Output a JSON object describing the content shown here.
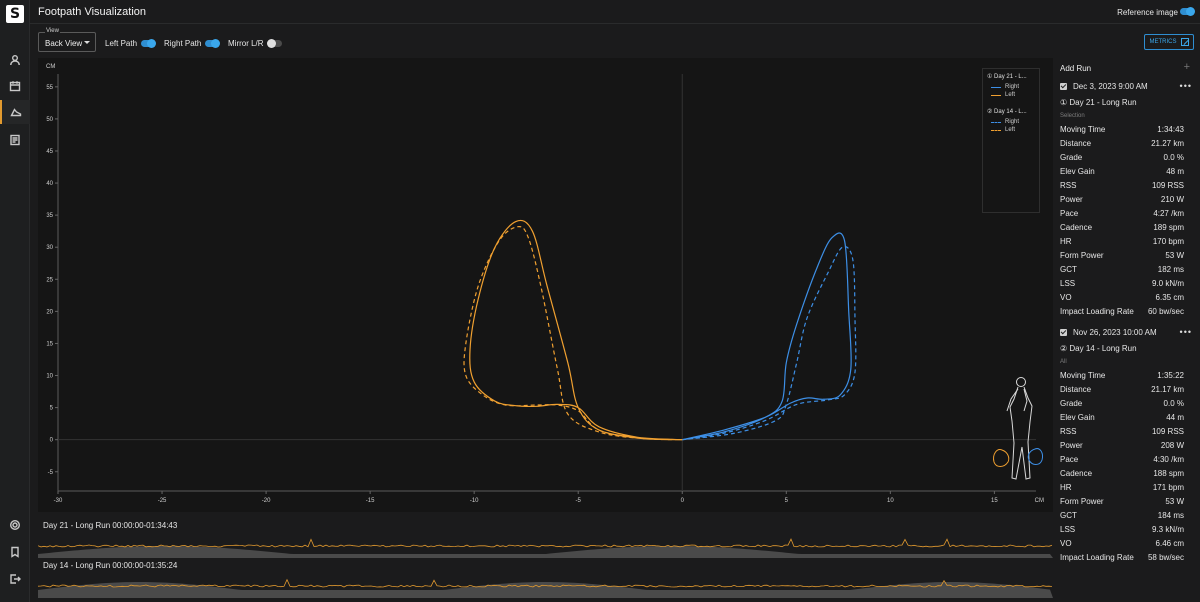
{
  "app": {
    "logo": "S",
    "title": "Footpath Visualization",
    "reference_label": "Reference image",
    "reference_on": true
  },
  "sidebar": {
    "items": [
      {
        "name": "profile",
        "icon": "person-icon"
      },
      {
        "name": "calendar",
        "icon": "calendar-icon"
      },
      {
        "name": "footpath",
        "icon": "shoe-icon",
        "active": true
      },
      {
        "name": "reports",
        "icon": "report-icon"
      }
    ],
    "bottom": [
      {
        "name": "settings",
        "icon": "gear-icon"
      },
      {
        "name": "bookmark",
        "icon": "bookmark-icon"
      },
      {
        "name": "logout",
        "icon": "logout-icon"
      }
    ]
  },
  "toolbar": {
    "view_caption": "View",
    "view_value": "Back View",
    "left_path": "Left Path",
    "right_path": "Right Path",
    "mirror": "Mirror L/R",
    "left_on": true,
    "right_on": true,
    "mirror_on": false,
    "metrics_label": "METRICS"
  },
  "legend": {
    "groups": [
      {
        "title": "① Day 21 - L...",
        "entries": [
          {
            "label": "Right",
            "style": "solid",
            "color": "#3d8fe6"
          },
          {
            "label": "Left",
            "style": "solid",
            "color": "#f0a030"
          }
        ]
      },
      {
        "title": "② Day 14 - L...",
        "entries": [
          {
            "label": "Right",
            "style": "dashed",
            "color": "#3d8fe6"
          },
          {
            "label": "Left",
            "style": "dashed",
            "color": "#f0a030"
          }
        ]
      }
    ]
  },
  "chart_data": {
    "type": "line",
    "xunit": "CM",
    "yunit": "CM",
    "xlim": [
      -30,
      17
    ],
    "ylim": [
      -8,
      57
    ],
    "xticks": [
      -30,
      -25,
      -20,
      -15,
      -10,
      -5,
      0,
      5,
      10,
      15
    ],
    "yticks": [
      -5,
      0,
      5,
      10,
      15,
      20,
      25,
      30,
      35,
      40,
      45,
      50,
      55
    ],
    "series": [
      {
        "name": "Right",
        "color": "#3d8fe6",
        "style": "solid",
        "points": [
          [
            0,
            0
          ],
          [
            2,
            1.2
          ],
          [
            4,
            3.5
          ],
          [
            4.8,
            6
          ],
          [
            5,
            12
          ],
          [
            5.5,
            18
          ],
          [
            6.5,
            27
          ],
          [
            7.2,
            31.5
          ],
          [
            7.8,
            31
          ],
          [
            8,
            20
          ],
          [
            8.1,
            11
          ],
          [
            7.6,
            7
          ],
          [
            6.8,
            6.3
          ],
          [
            6,
            6.5
          ],
          [
            5.2,
            5.7
          ],
          [
            4,
            3.5
          ],
          [
            2,
            1.5
          ],
          [
            0,
            0
          ]
        ]
      },
      {
        "name": "Right",
        "color": "#3d8fe6",
        "style": "dashed",
        "points": [
          [
            0,
            0
          ],
          [
            2.5,
            1
          ],
          [
            4.5,
            3
          ],
          [
            5,
            5.5
          ],
          [
            5.5,
            12
          ],
          [
            6,
            19
          ],
          [
            7,
            26
          ],
          [
            7.7,
            30
          ],
          [
            8.2,
            28
          ],
          [
            8.3,
            19
          ],
          [
            8.3,
            10.5
          ],
          [
            7.8,
            7
          ],
          [
            7,
            6.2
          ],
          [
            5.5,
            5.5
          ],
          [
            4,
            3
          ],
          [
            2,
            1
          ],
          [
            0,
            0
          ]
        ]
      },
      {
        "name": "Left",
        "color": "#f0a030",
        "style": "solid",
        "points": [
          [
            0,
            0
          ],
          [
            -2,
            0.3
          ],
          [
            -4,
            1.5
          ],
          [
            -5,
            5
          ],
          [
            -5.5,
            12
          ],
          [
            -6.5,
            24
          ],
          [
            -7.2,
            32.5
          ],
          [
            -8,
            34
          ],
          [
            -9,
            30
          ],
          [
            -9.8,
            22
          ],
          [
            -10.2,
            14
          ],
          [
            -10,
            9
          ],
          [
            -9,
            6
          ],
          [
            -8,
            5.3
          ],
          [
            -7,
            5.2
          ],
          [
            -6,
            5.5
          ],
          [
            -5,
            5
          ],
          [
            -4,
            2
          ],
          [
            -2,
            0.3
          ],
          [
            0,
            0
          ]
        ]
      },
      {
        "name": "Left",
        "color": "#f0a030",
        "style": "dashed",
        "points": [
          [
            0,
            0
          ],
          [
            -2,
            0.2
          ],
          [
            -4,
            1.2
          ],
          [
            -5.5,
            4
          ],
          [
            -6,
            11
          ],
          [
            -6.8,
            24
          ],
          [
            -7.4,
            31.5
          ],
          [
            -7.9,
            33.2
          ],
          [
            -8.8,
            31
          ],
          [
            -9.8,
            24
          ],
          [
            -10.4,
            15
          ],
          [
            -10.4,
            10
          ],
          [
            -9.6,
            7
          ],
          [
            -8.5,
            5.4
          ],
          [
            -7,
            5.4
          ],
          [
            -6,
            5.4
          ],
          [
            -5,
            4.5
          ],
          [
            -4,
            1.5
          ],
          [
            -2,
            0.2
          ],
          [
            0,
            0
          ]
        ]
      }
    ]
  },
  "timelines": [
    {
      "label": "Day 21 - Long Run   00:00:00-01:34:43"
    },
    {
      "label": "Day 14 - Long Run   00:00:00-01:35:24"
    }
  ],
  "panel": {
    "add_run": "Add Run",
    "runs": [
      {
        "date": "Dec 3, 2023 9:00 AM",
        "name": "① Day 21 - Long Run",
        "sub": "Selection",
        "metrics": [
          {
            "label": "Moving Time",
            "value": "1:34:43"
          },
          {
            "label": "Distance",
            "value": "21.27 km"
          },
          {
            "label": "Grade",
            "value": "0.0 %"
          },
          {
            "label": "Elev Gain",
            "value": "48 m"
          },
          {
            "label": "RSS",
            "value": "109 RSS"
          },
          {
            "label": "Power",
            "value": "210 W"
          },
          {
            "label": "Pace",
            "value": "4:27 /km"
          },
          {
            "label": "Cadence",
            "value": "189 spm"
          },
          {
            "label": "HR",
            "value": "170 bpm"
          },
          {
            "label": "Form Power",
            "value": "53 W"
          },
          {
            "label": "GCT",
            "value": "182 ms"
          },
          {
            "label": "LSS",
            "value": "9.0 kN/m"
          },
          {
            "label": "VO",
            "value": "6.35 cm"
          },
          {
            "label": "Impact Loading Rate",
            "value": "60 bw/sec"
          }
        ]
      },
      {
        "date": "Nov 26, 2023 10:00 AM",
        "name": "② Day 14 - Long Run",
        "sub": "All",
        "metrics": [
          {
            "label": "Moving Time",
            "value": "1:35:22"
          },
          {
            "label": "Distance",
            "value": "21.17 km"
          },
          {
            "label": "Grade",
            "value": "0.0 %"
          },
          {
            "label": "Elev Gain",
            "value": "44 m"
          },
          {
            "label": "RSS",
            "value": "109 RSS"
          },
          {
            "label": "Power",
            "value": "208 W"
          },
          {
            "label": "Pace",
            "value": "4:30 /km"
          },
          {
            "label": "Cadence",
            "value": "188 spm"
          },
          {
            "label": "HR",
            "value": "171 bpm"
          },
          {
            "label": "Form Power",
            "value": "53 W"
          },
          {
            "label": "GCT",
            "value": "184 ms"
          },
          {
            "label": "LSS",
            "value": "9.3 kN/m"
          },
          {
            "label": "VO",
            "value": "6.46 cm"
          },
          {
            "label": "Impact Loading Rate",
            "value": "58 bw/sec"
          }
        ]
      }
    ]
  }
}
